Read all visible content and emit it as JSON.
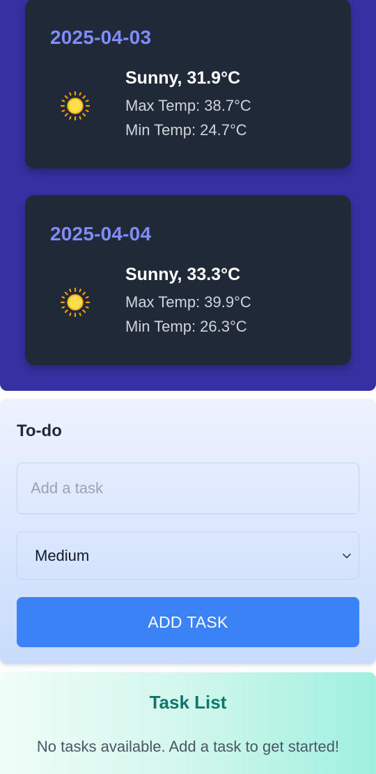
{
  "forecast": [
    {
      "date": "2025-04-03",
      "icon": "sun-icon",
      "condition": "Sunny, 31.9°C",
      "max_temp": "Max Temp: 38.7°C",
      "min_temp": "Min Temp: 24.7°C"
    },
    {
      "date": "2025-04-04",
      "icon": "sun-icon",
      "condition": "Sunny, 33.3°C",
      "max_temp": "Max Temp: 39.9°C",
      "min_temp": "Min Temp: 26.3°C"
    }
  ],
  "todo": {
    "title": "To-do",
    "input_placeholder": "Add a task",
    "input_value": "",
    "priority_selected": "Medium",
    "add_button_label": "ADD TASK"
  },
  "task_list": {
    "title": "Task List",
    "empty_message": "No tasks available. Add a task to get started!"
  },
  "colors": {
    "weather_panel_bg": "#3730a3",
    "card_bg": "#1f2937",
    "date_color": "#818cf8",
    "button_bg": "#3b82f6",
    "task_list_title": "#0f766e"
  }
}
